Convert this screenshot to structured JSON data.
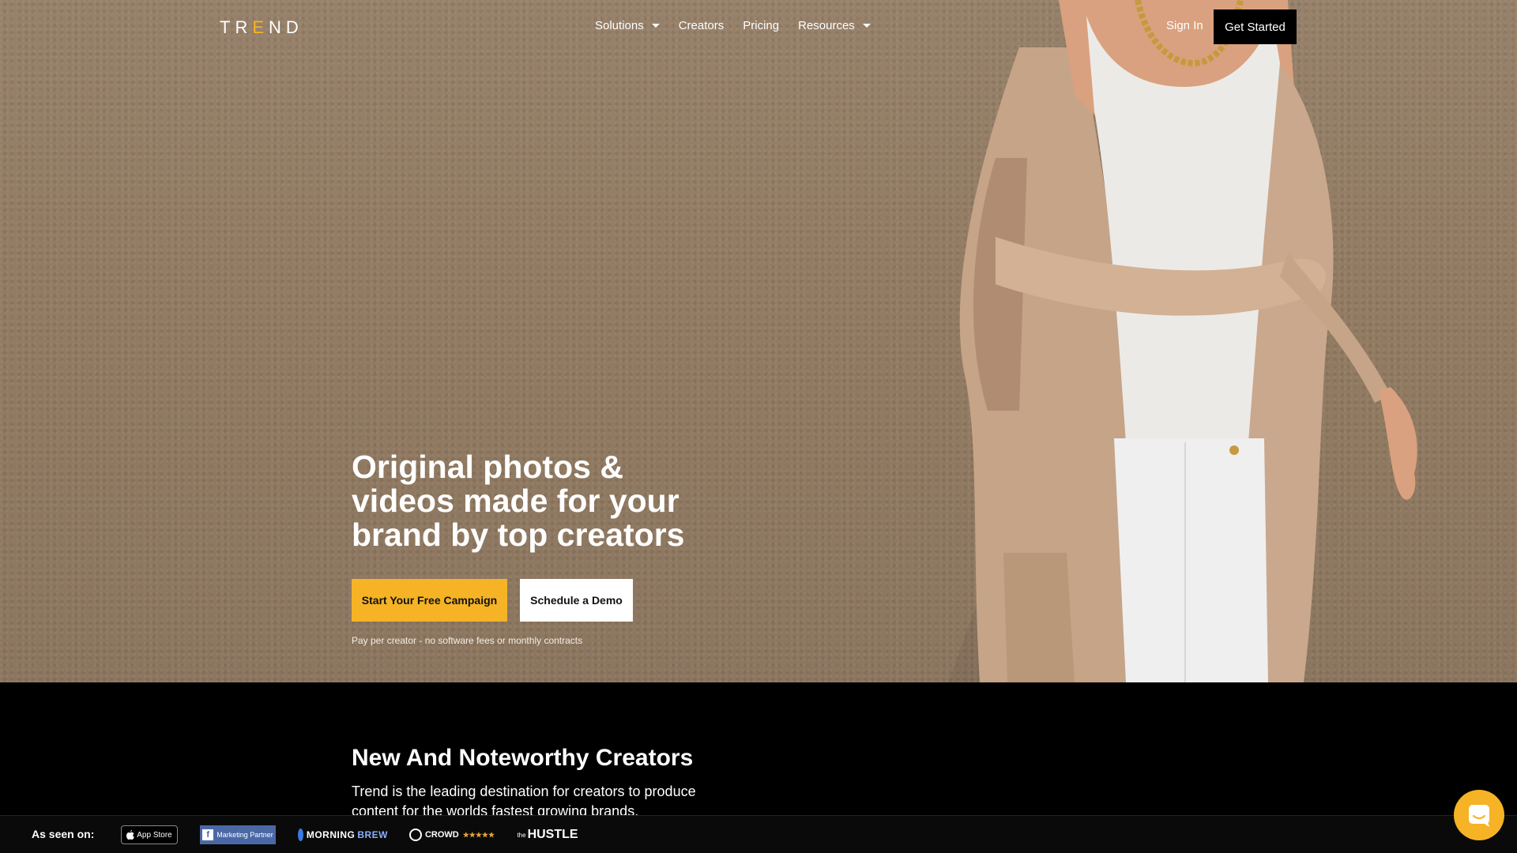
{
  "brand": {
    "logo_pre": "TR",
    "logo_e": "E",
    "logo_post": "ND"
  },
  "nav": {
    "items": [
      {
        "label": "Solutions",
        "has_dropdown": true
      },
      {
        "label": "Creators",
        "has_dropdown": false
      },
      {
        "label": "Pricing",
        "has_dropdown": false
      },
      {
        "label": "Resources",
        "has_dropdown": true
      }
    ],
    "sign_in": "Sign In",
    "get_started": "Get Started"
  },
  "hero": {
    "title": "Original photos & videos made for your brand by top creators",
    "primary_cta": "Start Your Free Campaign",
    "secondary_cta": "Schedule a Demo",
    "note": "Pay per creator - no software fees or monthly contracts"
  },
  "creators_section": {
    "title": "New And Noteworthy Creators",
    "description": "Trend is the leading destination for creators to produce content for the worlds fastest growing brands."
  },
  "seen_on": {
    "label": "As seen on:",
    "badges": {
      "app_store": "App Store",
      "facebook": "Marketing Partner",
      "brew_a": "MORNING",
      "brew_b": "BREW",
      "g2": "CROWD",
      "g2_stars": "★★★★★",
      "hustle_pre": "the",
      "hustle": "HUSTLE"
    }
  },
  "icons": {
    "chat": "chat-bubble-icon",
    "dropdown": "caret-down-icon",
    "apple": "apple-icon",
    "facebook": "facebook-icon"
  },
  "colors": {
    "accent": "#f5b325",
    "hero_bg": "#927b62",
    "dark": "#000000"
  }
}
